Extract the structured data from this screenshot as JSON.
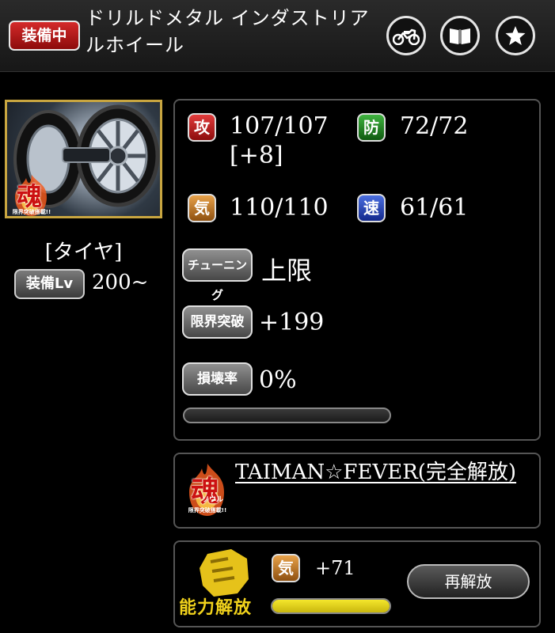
{
  "header": {
    "equipped_badge": "装備中",
    "title": "ドリルドメタル インダストリアルホイール",
    "buttons": [
      "motorcycle-icon",
      "book-icon",
      "star-icon"
    ]
  },
  "item": {
    "type": "[タイヤ]",
    "equip_lv_label": "装備Lv",
    "equip_lv_value": "200~",
    "soul_badge_text": [
      "魂",
      "ソウル",
      "限界突破搭載!!"
    ]
  },
  "stats": {
    "attack": {
      "icon": "攻",
      "value": "107/107",
      "bonus": "[+8]",
      "color": "#c81f1f"
    },
    "defense": {
      "icon": "防",
      "value": "72/72",
      "color": "#1f8a1f"
    },
    "spirit": {
      "icon": "気",
      "value": "110/110",
      "color": "#c37a24"
    },
    "speed": {
      "icon": "速",
      "value": "61/61",
      "color": "#2443b8"
    },
    "tuning_label": "チューニング",
    "tuning_value": "上限",
    "limit_break_label": "限界突破",
    "limit_break_value": "+199",
    "damage_rate_label": "損壊率",
    "damage_rate_value": "0%",
    "damage_rate_fraction": 0
  },
  "skill": {
    "name": "TAIMAN☆FEVER(完全解放)"
  },
  "ability": {
    "emblem_text": "能力解放",
    "icon": "気",
    "bonus": "+71",
    "progress_fraction": 1,
    "rerelease_label": "再解放"
  }
}
